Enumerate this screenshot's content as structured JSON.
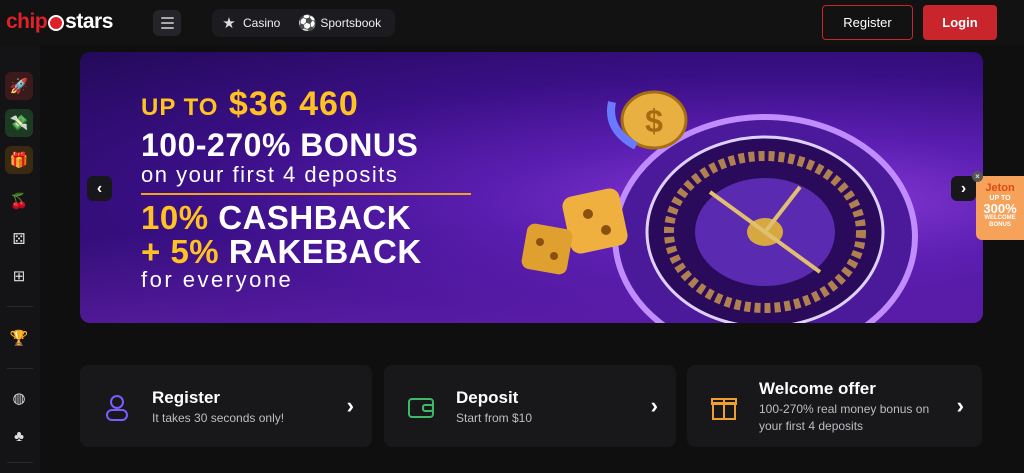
{
  "header": {
    "logo_left": "chip",
    "logo_right": "stars",
    "nav": [
      {
        "icon": "star-icon",
        "label": "Casino"
      },
      {
        "icon": "soccer-ball-icon",
        "label": "Sportsbook"
      }
    ],
    "register_label": "Register",
    "login_label": "Login"
  },
  "sidebar": {
    "items": [
      {
        "icon": "rocket-icon"
      },
      {
        "icon": "money-icon"
      },
      {
        "icon": "gift-box-icon"
      },
      {
        "icon": "cherries-icon"
      },
      {
        "icon": "dice-icon"
      },
      {
        "icon": "gift-icon"
      },
      {
        "icon": "trophy-icon"
      },
      {
        "icon": "basketball-icon"
      },
      {
        "icon": "clubs-icon"
      }
    ]
  },
  "banner": {
    "line1_prefix": "UP TO",
    "line1_amount": "$36 460",
    "line2": "100-270% BONUS",
    "line3": "on your first 4 deposits",
    "line4_value": "10%",
    "line4_text": "CASHBACK",
    "line5_value": "+ 5%",
    "line5_text": "RAKEBACK",
    "line6": "for everyone",
    "prev": "‹",
    "next": "›"
  },
  "promo": {
    "brand": "Jeton",
    "t1": "UP TO",
    "t2": "300%",
    "t3a": "WELCOME",
    "t3b": "BONUS"
  },
  "cards": [
    {
      "title": "Register",
      "subtitle": "It takes 30 seconds only!",
      "icon": "user-icon",
      "color": "#7b5cff"
    },
    {
      "title": "Deposit",
      "subtitle": "Start from $10",
      "icon": "wallet-icon",
      "color": "#3fb86a"
    },
    {
      "title": "Welcome offer",
      "subtitle": "100-270% real money bonus on your first 4 deposits",
      "icon": "gift-icon",
      "color": "#f0a030"
    }
  ],
  "colors": {
    "brand_red": "#c9252d",
    "gold": "#ffc222"
  }
}
